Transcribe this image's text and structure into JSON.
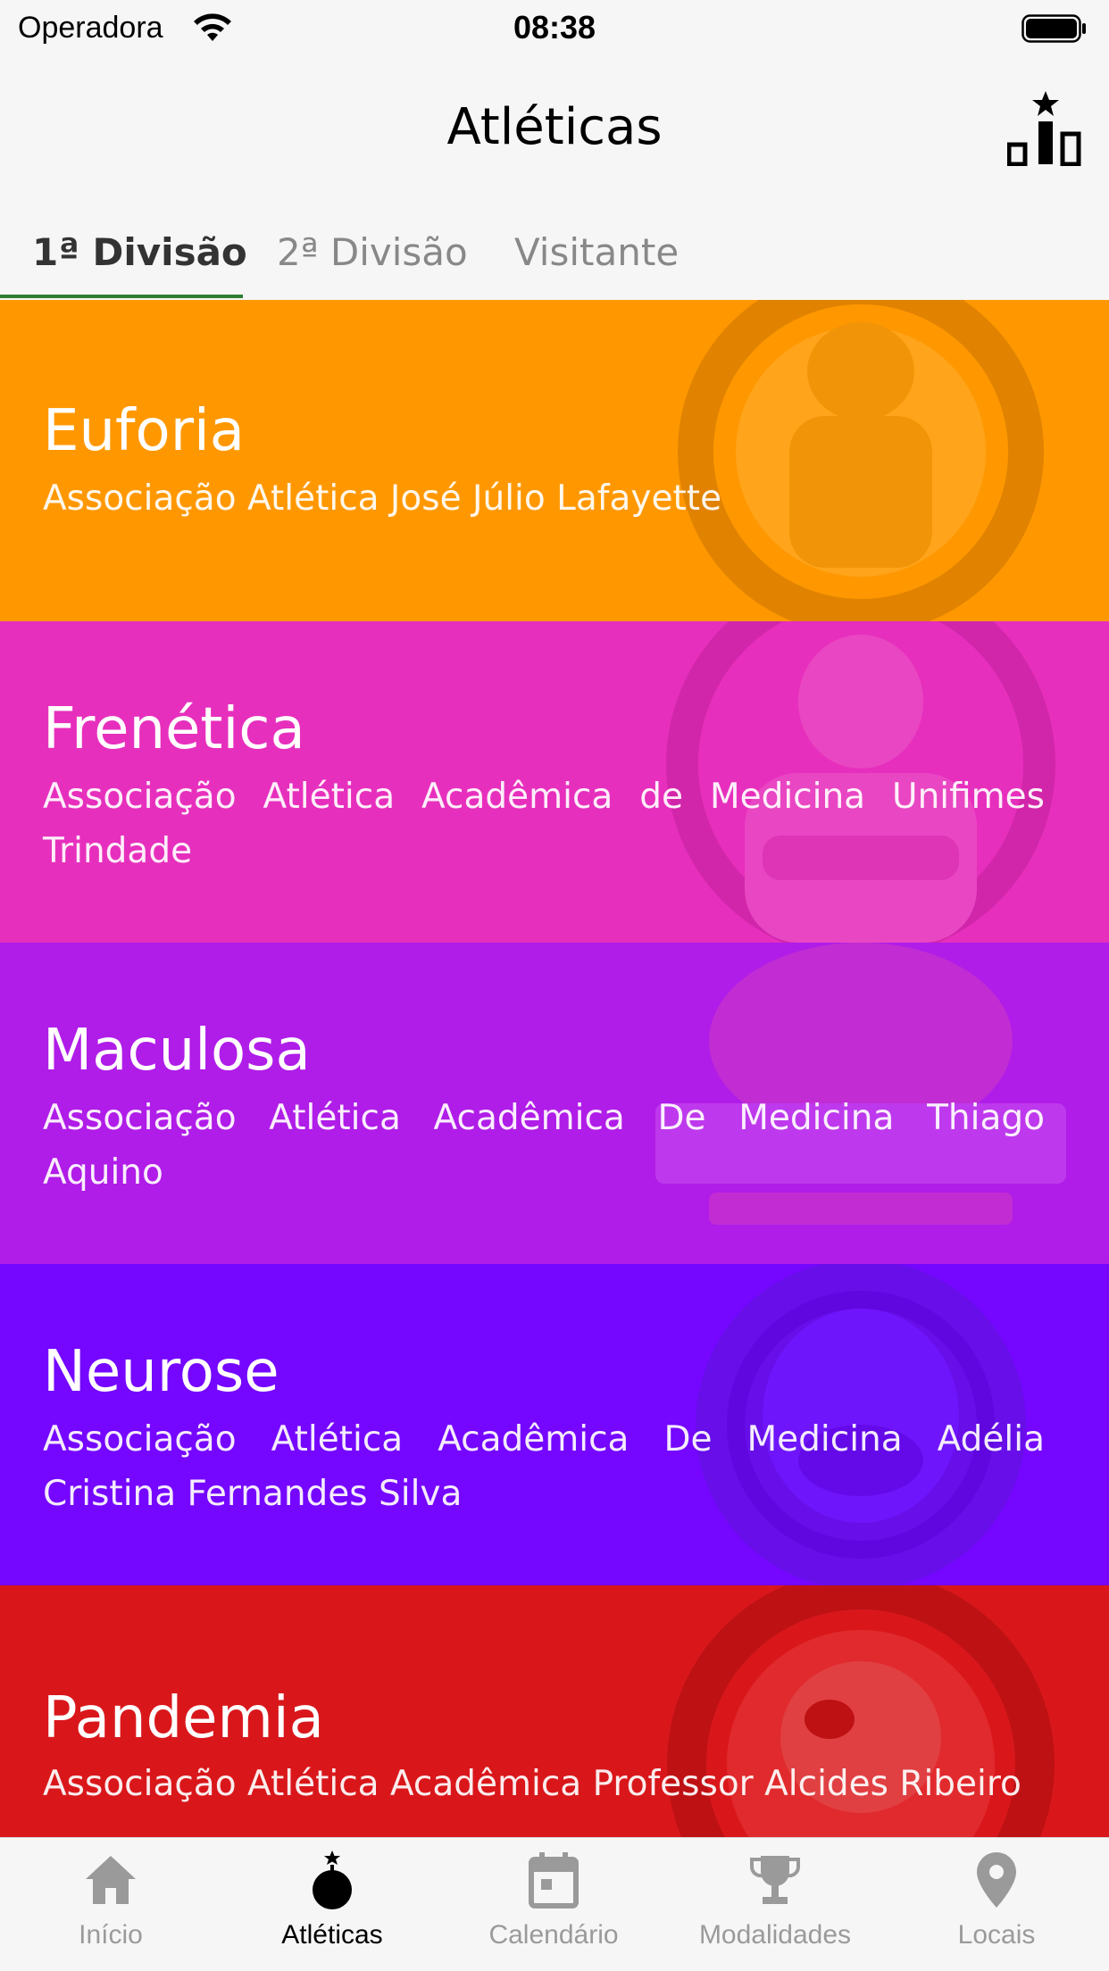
{
  "status": {
    "carrier": "Operadora",
    "time": "08:38"
  },
  "nav": {
    "title": "Atléticas",
    "right_icon": "ranking-podium-icon"
  },
  "tabs": [
    {
      "label": "1ª Divisão",
      "active": true
    },
    {
      "label": "2ª Divisão",
      "active": false
    },
    {
      "label": "Visitante",
      "active": false
    }
  ],
  "athletics": [
    {
      "name": "Euforia",
      "description": "Associação Atlética José Júlio Lafayette",
      "color": "#ff9800"
    },
    {
      "name": "Frenética",
      "description": "Associação Atlética Acadêmica de Medicina Unifimes Trindade",
      "color": "#e72fbd"
    },
    {
      "name": "Maculosa",
      "description": "Associação Atlética Acadêmica De Medicina Thiago Aquino",
      "color": "#b01ce8"
    },
    {
      "name": "Neurose",
      "description": "Associação Atlética Acadêmica De Medicina Adélia Cristina Fernandes Silva",
      "color": "#7506ff"
    },
    {
      "name": "Pandemia",
      "description": "Associação Atlética Acadêmica Professor Alcides Ribeiro",
      "color": "#d9171b"
    }
  ],
  "tabbar": [
    {
      "label": "Início",
      "icon": "home-icon",
      "active": false
    },
    {
      "label": "Atléticas",
      "icon": "bomb-star-icon",
      "active": true
    },
    {
      "label": "Calendário",
      "icon": "calendar-icon",
      "active": false
    },
    {
      "label": "Modalidades",
      "icon": "trophy-icon",
      "active": false
    },
    {
      "label": "Locais",
      "icon": "location-pin-icon",
      "active": false
    }
  ]
}
